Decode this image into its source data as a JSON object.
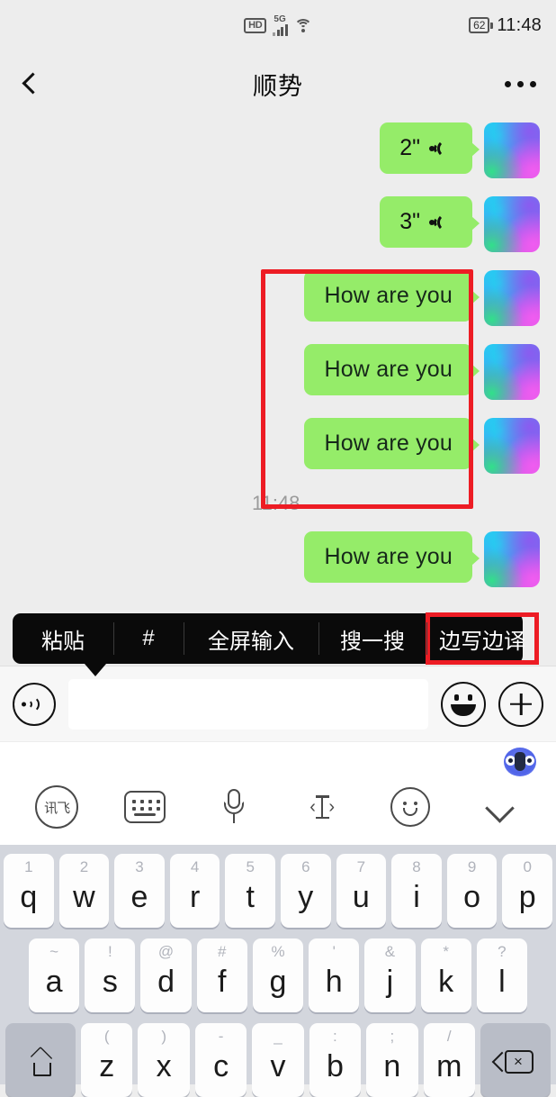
{
  "status_bar": {
    "hd_label": "HD",
    "network_label": "5G",
    "wifi_icon": "wifi-icon",
    "battery_level": "62",
    "time": "11:48"
  },
  "nav_bar": {
    "back_icon": "back-chevron-icon",
    "title": "顺势",
    "more_icon": "more-options-icon"
  },
  "chat": {
    "messages": [
      {
        "type": "voice",
        "duration": "2\"",
        "icon": "sound-wave-icon"
      },
      {
        "type": "voice",
        "duration": "3\"",
        "icon": "sound-wave-icon"
      },
      {
        "type": "text",
        "text": "How are you"
      },
      {
        "type": "text",
        "text": "How are you"
      },
      {
        "type": "text",
        "text": "How are you"
      }
    ],
    "timestamp": "11:48",
    "partial_message": {
      "type": "text",
      "text": "How are you"
    }
  },
  "context_menu": {
    "items": [
      {
        "label": "粘贴",
        "highlighted": false
      },
      {
        "label": "#",
        "highlighted": false
      },
      {
        "label": "全屏输入",
        "highlighted": false
      },
      {
        "label": "搜一搜",
        "highlighted": false
      },
      {
        "label": "边写边译",
        "highlighted": true
      }
    ]
  },
  "input_bar": {
    "voice_icon": "voice-input-icon",
    "text_value": "",
    "placeholder": "",
    "emoji_icon": "emoji-icon",
    "plus_icon": "plus-icon"
  },
  "ime_toolbar": {
    "mascot_icon": "mascot-avatar-icon",
    "buttons": [
      {
        "icon": "iflytek-logo-icon",
        "label": "讯飞"
      },
      {
        "icon": "keyboard-icon",
        "label": ""
      },
      {
        "icon": "microphone-icon",
        "label": ""
      },
      {
        "icon": "cursor-move-icon",
        "label": ""
      },
      {
        "icon": "smiley-icon",
        "label": ""
      },
      {
        "icon": "chevron-down-icon",
        "label": ""
      }
    ]
  },
  "keyboard": {
    "row1": [
      {
        "sup": "1",
        "main": "q"
      },
      {
        "sup": "2",
        "main": "w"
      },
      {
        "sup": "3",
        "main": "e"
      },
      {
        "sup": "4",
        "main": "r"
      },
      {
        "sup": "5",
        "main": "t"
      },
      {
        "sup": "6",
        "main": "y"
      },
      {
        "sup": "7",
        "main": "u"
      },
      {
        "sup": "8",
        "main": "i"
      },
      {
        "sup": "9",
        "main": "o"
      },
      {
        "sup": "0",
        "main": "p"
      }
    ],
    "row2": [
      {
        "sup": "~",
        "main": "a"
      },
      {
        "sup": "!",
        "main": "s"
      },
      {
        "sup": "@",
        "main": "d"
      },
      {
        "sup": "#",
        "main": "f"
      },
      {
        "sup": "%",
        "main": "g"
      },
      {
        "sup": "'",
        "main": "h"
      },
      {
        "sup": "&",
        "main": "j"
      },
      {
        "sup": "*",
        "main": "k"
      },
      {
        "sup": "?",
        "main": "l"
      }
    ],
    "row3": [
      {
        "sup": "(",
        "main": "z"
      },
      {
        "sup": ")",
        "main": "x"
      },
      {
        "sup": "-",
        "main": "c"
      },
      {
        "sup": "_",
        "main": "v"
      },
      {
        "sup": ":",
        "main": "b"
      },
      {
        "sup": ";",
        "main": "n"
      },
      {
        "sup": "/",
        "main": "m"
      }
    ],
    "shift_icon": "shift-key-icon",
    "backspace_icon": "backspace-key-icon",
    "backspace_glyph": "×"
  },
  "annotations": {
    "message_highlight_color": "#ed1c24",
    "menu_highlight_color": "#ed1c24"
  }
}
